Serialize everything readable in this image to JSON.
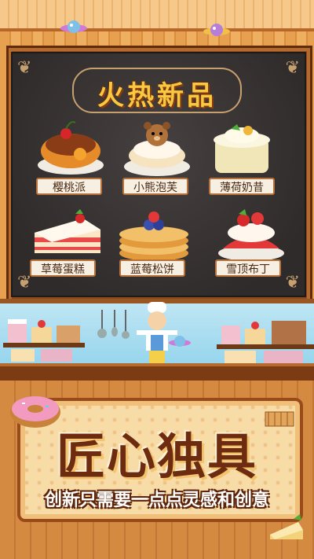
{
  "board": {
    "title": "火热新品",
    "items": [
      {
        "label": "樱桃派"
      },
      {
        "label": "小熊泡芙"
      },
      {
        "label": "薄荷奶昔"
      },
      {
        "label": "草莓蛋糕"
      },
      {
        "label": "蓝莓松饼"
      },
      {
        "label": "雪顶布丁"
      }
    ]
  },
  "banner": {
    "title": "匠心独具",
    "subtitle": "创新只需要一点点灵感和创意"
  },
  "colors": {
    "title_gold": "#f6c940",
    "board_dark": "#2f2b2a",
    "banner_text": "#6d2b10",
    "wood": "#c9782e"
  },
  "icons": [
    "planet-icon",
    "donut-icon",
    "chef-character-icon",
    "cake-slice-icon",
    "candy-icon"
  ]
}
